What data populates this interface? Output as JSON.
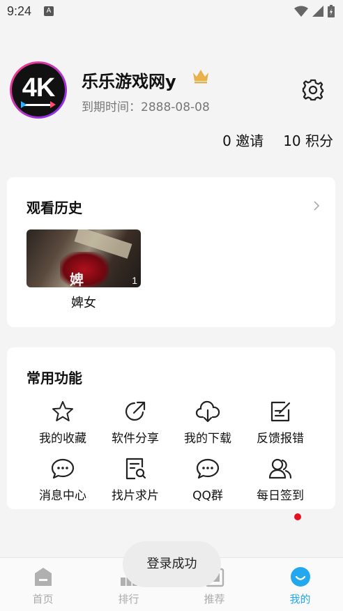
{
  "status_bar": {
    "time": "9:24",
    "notification_glyph": "A"
  },
  "profile": {
    "avatar_text": "4K",
    "username": "乐乐游戏网y",
    "expiry_label": "到期时间：2888-08-08",
    "invites": "0 邀请",
    "points": "10 积分",
    "vip_color": "#e8b04a"
  },
  "history": {
    "title": "观看历史",
    "items": [
      {
        "title": "婢女",
        "thumb_overlay": "婢",
        "episode": "1"
      }
    ]
  },
  "functions": {
    "title": "常用功能",
    "items": [
      {
        "label": "我的收藏",
        "icon": "star-icon"
      },
      {
        "label": "软件分享",
        "icon": "share-icon"
      },
      {
        "label": "我的下载",
        "icon": "cloud-download-icon"
      },
      {
        "label": "反馈报错",
        "icon": "feedback-edit-icon"
      },
      {
        "label": "消息中心",
        "icon": "message-icon"
      },
      {
        "label": "找片求片",
        "icon": "search-document-icon"
      },
      {
        "label": "QQ群",
        "icon": "chat-bubble-icon"
      },
      {
        "label": "每日签到",
        "icon": "users-icon",
        "badge": true
      }
    ]
  },
  "toast": "登录成功",
  "tabbar": {
    "active_color": "#22a8ee",
    "tabs": [
      {
        "label": "首页",
        "icon": "home-icon"
      },
      {
        "label": "排行",
        "icon": "ranking-icon"
      },
      {
        "label": "推荐",
        "icon": "recommend-icon"
      },
      {
        "label": "我的",
        "icon": "profile-smile-icon",
        "active": true
      }
    ]
  }
}
